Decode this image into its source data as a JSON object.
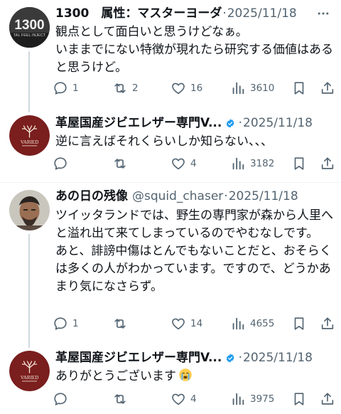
{
  "posts": [
    {
      "author": "1300　属性：マスターヨーダ",
      "handle": "",
      "date": "2025/11/18",
      "verified": false,
      "avatar_text": "1300",
      "avatar_subtext": "TAL FEEL INJECT",
      "text": "観点として面白いと思うけどなぁ。\nいままでにない特徴が現れたら研究する価値はあると思うけど。",
      "replies": "1",
      "reposts": "2",
      "likes": "16",
      "views": "3610"
    },
    {
      "author": "革屋国産ジビエレザー専門V...",
      "handle": "",
      "date": "2025/11/18",
      "verified": true,
      "avatar_text": "VARIED",
      "text": "逆に言えばそれくらいしか知らない、、、",
      "replies": "",
      "reposts": "",
      "likes": "4",
      "views": "3182"
    },
    {
      "author": "あの日の残像",
      "handle": "@squid_chaser",
      "date": "2025/11/18",
      "verified": false,
      "text": "ツイッタランドでは、野生の専門家が森から人里へと溢れ出て来てしまっているのでやむなしです。\nあと、誹謗中傷はとんでもないことだと、おそらくは多くの人がわかっています。ですので、どうかあまり気になさらず。",
      "replies": "1",
      "reposts": "",
      "likes": "14",
      "views": "4655"
    },
    {
      "author": "革屋国産ジビエレザー専門V...",
      "handle": "",
      "date": "2025/11/18",
      "verified": true,
      "avatar_text": "VARIED",
      "text": "ありがとうございます",
      "replies": "",
      "reposts": "",
      "likes": "4",
      "views": "3975"
    }
  ],
  "colors": {
    "text": "#0f1419",
    "secondary": "#536471",
    "verified": "#1d9bf0",
    "avatar_red": "#7a1e1e",
    "divider": "#eff3f4"
  },
  "icons": [
    "reply-icon",
    "repost-icon",
    "like-icon",
    "views-icon",
    "bookmark-icon",
    "share-icon",
    "more-icon",
    "verified-badge-icon",
    "crying-face-icon"
  ]
}
